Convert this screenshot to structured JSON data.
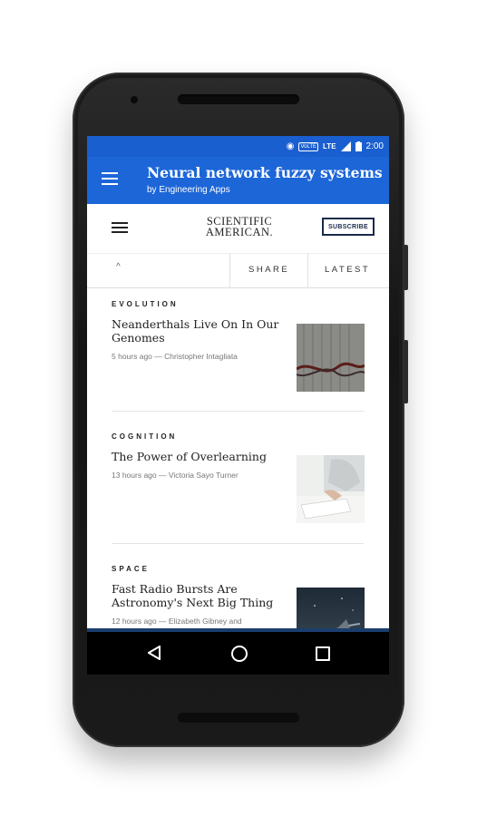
{
  "statusbar": {
    "network": "LTE",
    "volte": "VoLTE",
    "time": "2:00"
  },
  "appbar": {
    "title": "Neural network fuzzy systems",
    "subtitle": "by Engineering Apps"
  },
  "sa_header": {
    "logo_line1": "SCIENTIFIC",
    "logo_line2": "AMERICAN.",
    "subscribe_label": "SUBSCRIBE"
  },
  "toolbar": {
    "caret": "^",
    "share_label": "SHARE",
    "latest_label": "LATEST"
  },
  "articles": [
    {
      "category": "EVOLUTION",
      "headline": "Neanderthals Live On In Our Genomes",
      "byline": "5 hours ago — Christopher Intagliata",
      "thumb_icon": "dna-strand-image"
    },
    {
      "category": "COGNITION",
      "headline": "The Power of Overlearning",
      "byline": "13 hours ago — Victoria Sayo Turner",
      "thumb_icon": "writing-desk-image"
    },
    {
      "category": "SPACE",
      "headline": "Fast Radio Bursts Are Astronomy's Next Big Thing",
      "byline": "12 hours ago — Elizabeth Gibney and",
      "thumb_icon": "radio-telescope-image"
    }
  ],
  "colors": {
    "status_blue": "#1a5fd0",
    "appbar_blue": "#1c66d8",
    "navy": "#1b2a4a"
  }
}
